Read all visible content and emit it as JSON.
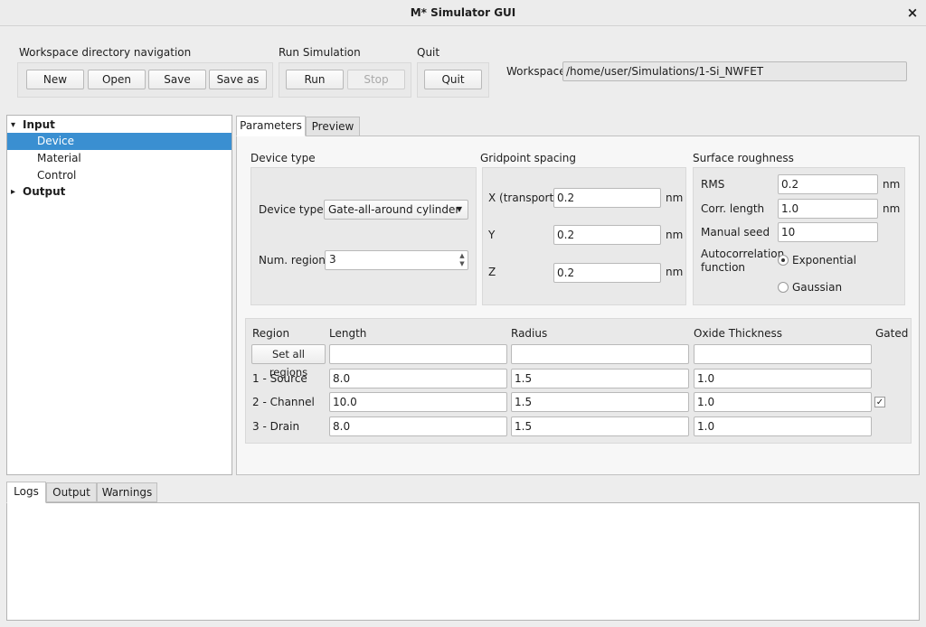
{
  "window": {
    "title": "M* Simulator GUI",
    "close_glyph": "×"
  },
  "toolbar": {
    "workspace_nav": {
      "label": "Workspace directory navigation",
      "new": "New",
      "open": "Open",
      "save": "Save",
      "save_as": "Save as"
    },
    "run": {
      "label": "Run Simulation",
      "run": "Run",
      "stop": "Stop"
    },
    "quit": {
      "label": "Quit",
      "quit": "Quit"
    },
    "workspace": {
      "label": "Workspace",
      "path": "/home/user/Simulations/1-Si_NWFET"
    }
  },
  "tree": {
    "input": "Input",
    "device": "Device",
    "material": "Material",
    "control": "Control",
    "output": "Output",
    "expanded_glyph": "▾",
    "collapsed_glyph": "▸"
  },
  "tabs": {
    "parameters": "Parameters",
    "preview": "Preview"
  },
  "device_type": {
    "group": "Device type",
    "type_label": "Device type",
    "type_value": "Gate-all-around cylinder",
    "regions_label": "Num. regions",
    "regions_value": "3"
  },
  "gridpoint": {
    "group": "Gridpoint spacing",
    "x_label": "X (transport)",
    "x_value": "0.2",
    "y_label": "Y",
    "y_value": "0.2",
    "z_label": "Z",
    "z_value": "0.2",
    "unit": "nm"
  },
  "roughness": {
    "group": "Surface roughness",
    "rms_label": "RMS",
    "rms_value": "0.2",
    "corr_label": "Corr. length",
    "corr_value": "1.0",
    "seed_label": "Manual seed",
    "seed_value": "10",
    "auto_label_1": "Autocorrelation",
    "auto_label_2": "function",
    "exponential": "Exponential",
    "gaussian": "Gaussian",
    "unit": "nm"
  },
  "regions": {
    "headers": {
      "region": "Region",
      "length": "Length",
      "radius": "Radius",
      "oxide": "Oxide Thickness",
      "gated": "Gated"
    },
    "set_all": "Set all regions",
    "rows": [
      {
        "name": "1 - Source",
        "length": "8.0",
        "radius": "1.5",
        "oxide": "1.0",
        "gated": false
      },
      {
        "name": "2 - Channel",
        "length": "10.0",
        "radius": "1.5",
        "oxide": "1.0",
        "gated": true
      },
      {
        "name": "3 - Drain",
        "length": "8.0",
        "radius": "1.5",
        "oxide": "1.0",
        "gated": false
      }
    ],
    "check_glyph": "✓"
  },
  "bottom_tabs": {
    "logs": "Logs",
    "output": "Output",
    "warnings": "Warnings"
  }
}
